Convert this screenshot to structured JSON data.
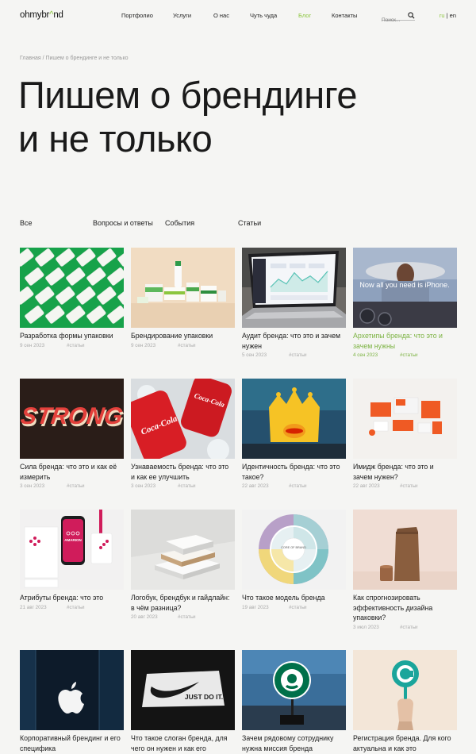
{
  "header": {
    "logo_a": "ohmybr",
    "logo_accent": "^",
    "logo_b": "nd",
    "nav": [
      "Портфолио",
      "Услуги",
      "О нас",
      "Чуть чуда",
      "Блог",
      "Контакты"
    ],
    "search_placeholder": "Поиск...",
    "lang_ru": "ru",
    "lang_sep": " | ",
    "lang_en": "en"
  },
  "breadcrumb": "Главная / Пишем о брендинге и не только",
  "title": "Пишем о брендинге и не только",
  "filters": [
    "Все",
    "Вопросы и ответы",
    "События",
    "Статьи"
  ],
  "cards": [
    {
      "title": "Разработка формы упаковки",
      "date": "9 сен 2023",
      "tag": "#статьи",
      "image": "white-packets-on-green"
    },
    {
      "title": "Брендирование упаковки",
      "date": "9 сен 2023",
      "tag": "#статьи",
      "image": "packaging-products"
    },
    {
      "title": "Аудит бренда: что это и зачем нужен",
      "date": "5 сен 2023",
      "tag": "#статьи",
      "image": "laptop-dashboard"
    },
    {
      "title": "Архетипы бренда: что это и зачем нужны",
      "date": "4 сен 2023",
      "tag": "#статьи",
      "image": "iphone-ad",
      "overlay": "Now all you need is iPhone."
    },
    {
      "title": "Сила бренда: что это и как её измерить",
      "date": "3 сен 2023",
      "tag": "#статьи",
      "image": "strong-lettering",
      "overlay": "STRONG"
    },
    {
      "title": "Узнаваемость бренда: что это и как ее улучшить",
      "date": "3 сен 2023",
      "tag": "#статьи",
      "image": "coca-cola-cans",
      "overlay": "Coca-Cola"
    },
    {
      "title": "Идентичность бренда: что это такое?",
      "date": "22 авг 2023",
      "tag": "#статьи",
      "image": "burger-king-crown"
    },
    {
      "title": "Имидж бренда: что это и зачем нужен?",
      "date": "22 авг 2023",
      "tag": "#статьи",
      "image": "orange-brand-mockups"
    },
    {
      "title": "Атрибуты бренда: что это",
      "date": "21 авг 2023",
      "tag": "#статьи",
      "image": "amarion-identity",
      "overlay": "AMARION"
    },
    {
      "title": "Логобук, брендбук и гайдлайн: в чём разница?",
      "date": "20 авг 2023",
      "tag": "#статьи",
      "image": "book-stack"
    },
    {
      "title": "Что такое модель бренда",
      "date": "19 авг 2023",
      "tag": "#статьи",
      "image": "brand-wheel",
      "overlay": "CORE OF BRAND"
    },
    {
      "title": "Как спрогнозировать эффективность дизайна упаковки?",
      "date": "3 июл 2023",
      "tag": "#статьи",
      "image": "coffee-pouch"
    },
    {
      "title": "Корпоративный брендинг и его специфика",
      "date": "",
      "tag": "",
      "image": "apple-store"
    },
    {
      "title": "Что такое слоган бренда, для чего он нужен и как его",
      "date": "",
      "tag": "",
      "image": "nike-just-do-it",
      "overlay": "JUST DO IT."
    },
    {
      "title": "Зачем рядовому сотруднику нужна миссия бренда",
      "date": "",
      "tag": "",
      "image": "starbucks-sign"
    },
    {
      "title": "Регистрация бренда. Для кого актуальна и как это",
      "date": "",
      "tag": "",
      "image": "copyright-hand"
    }
  ],
  "colors": {
    "accent": "#8cc63f",
    "background": "#f5f5f3",
    "text": "#1c1c1c",
    "muted": "#aaaaaa"
  }
}
